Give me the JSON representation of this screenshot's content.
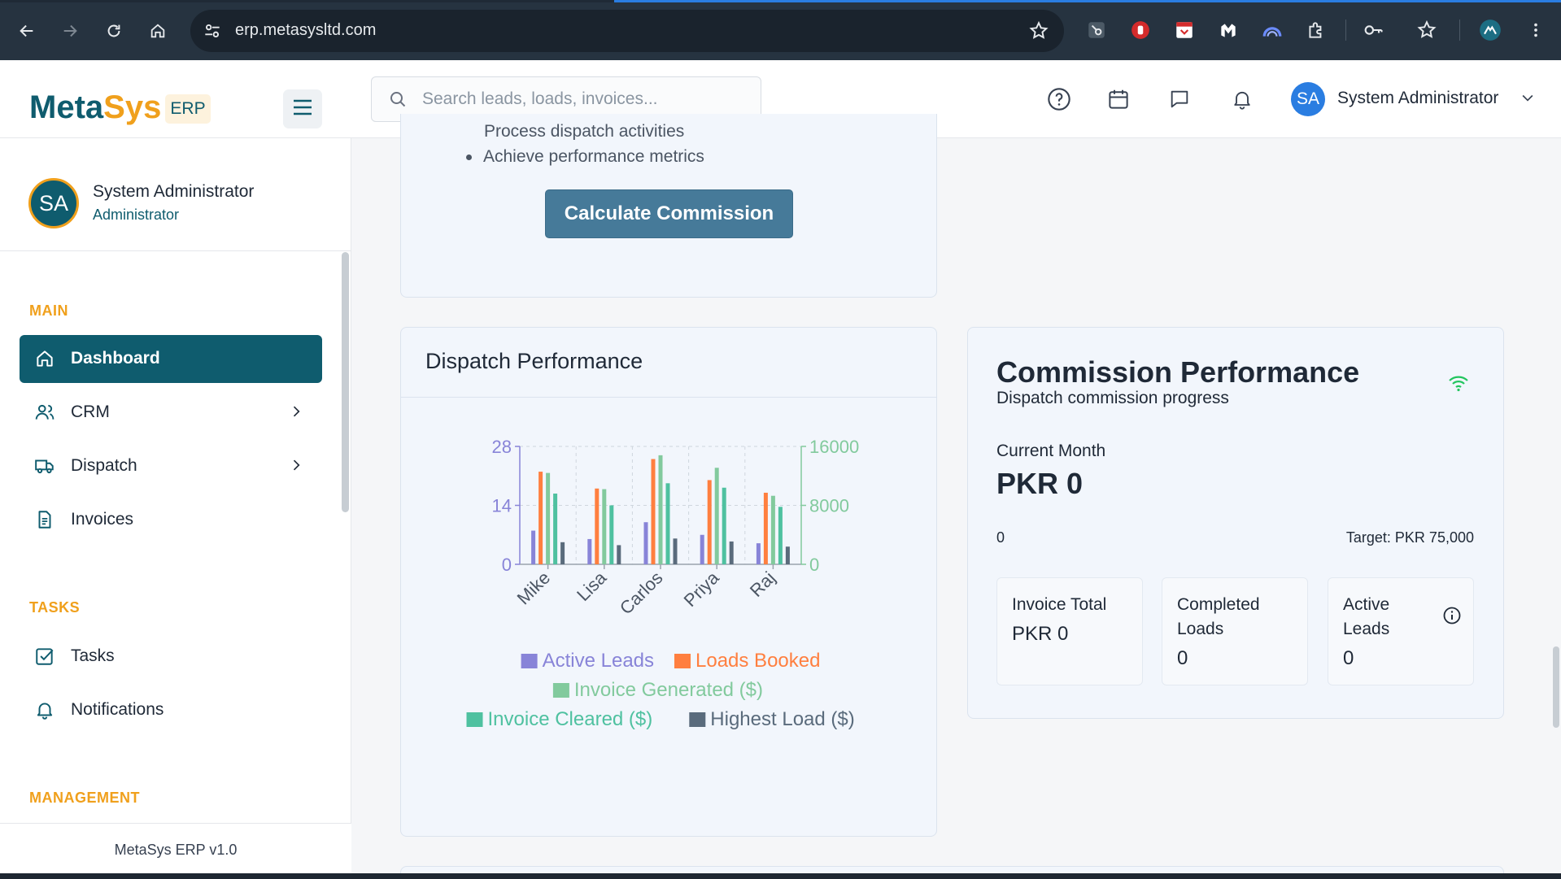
{
  "browser": {
    "url": "erp.metasysltd.com"
  },
  "header": {
    "brand_primary": "Meta",
    "brand_secondary": "Sys",
    "brand_tag": "ERP",
    "search_placeholder": "Search leads, loads, invoices...",
    "user_initials": "SA",
    "user_name": "System Administrator"
  },
  "sidebar": {
    "profile": {
      "initials": "SA",
      "name": "System Administrator",
      "role": "Administrator"
    },
    "sections": {
      "main": "MAIN",
      "tasks": "TASKS",
      "management": "MANAGEMENT"
    },
    "items": {
      "dashboard": "Dashboard",
      "crm": "CRM",
      "dispatch": "Dispatch",
      "invoices": "Invoices",
      "tasks": "Tasks",
      "notifications": "Notifications"
    },
    "footer": "MetaSys ERP v1.0"
  },
  "top_card": {
    "partial_bullet": "Process dispatch activities",
    "bullet": "Achieve performance metrics",
    "button": "Calculate Commission"
  },
  "dispatch_card": {
    "title": "Dispatch Performance"
  },
  "commission_card": {
    "title": "Commission Performance",
    "subtitle": "Dispatch commission progress",
    "current_month_label": "Current Month",
    "current_month_value": "PKR 0",
    "progress_value": "0",
    "target": "Target: PKR 75,000",
    "stats": {
      "invoice_total_label": "Invoice Total",
      "invoice_total_value": "PKR 0",
      "completed_loads_label": "Completed Loads",
      "completed_loads_value": "0",
      "active_leads_label": "Active Leads",
      "active_leads_value": "0"
    }
  },
  "colors": {
    "brand_teal": "#0f5c6e",
    "brand_orange": "#f0a01c",
    "active_leads": "#8884d8",
    "loads_booked": "#ff7f3f",
    "invoice_generated": "#82ca9d",
    "invoice_cleared": "#4fc1a0",
    "highest_load": "#5a6b7c"
  },
  "chart_data": {
    "type": "bar",
    "categories": [
      "Mike",
      "Lisa",
      "Carlos",
      "Priya",
      "Raj"
    ],
    "left_axis": {
      "ticks": [
        "0",
        "14",
        "28"
      ],
      "ylim": [
        0,
        28
      ]
    },
    "right_axis": {
      "ticks": [
        "0",
        "8000",
        "16000"
      ],
      "ylim": [
        0,
        16000
      ]
    },
    "series": [
      {
        "name": "Active Leads",
        "axis": "left",
        "color": "#8884d8",
        "values": [
          8,
          6,
          10,
          7,
          5
        ]
      },
      {
        "name": "Loads Booked",
        "axis": "left",
        "color": "#ff7f3f",
        "values": [
          22,
          18,
          25,
          20,
          17
        ]
      },
      {
        "name": "Invoice Generated ($)",
        "axis": "right",
        "color": "#82ca9d",
        "values": [
          12400,
          10200,
          14800,
          13100,
          9300
        ]
      },
      {
        "name": "Invoice Cleared ($)",
        "axis": "right",
        "color": "#4fc1a0",
        "values": [
          9600,
          8000,
          11000,
          10400,
          7800
        ]
      },
      {
        "name": "Highest Load ($)",
        "axis": "right",
        "color": "#5a6b7c",
        "values": [
          3000,
          2600,
          3500,
          3100,
          2400
        ]
      }
    ],
    "grid": true,
    "legend": "bottom"
  }
}
